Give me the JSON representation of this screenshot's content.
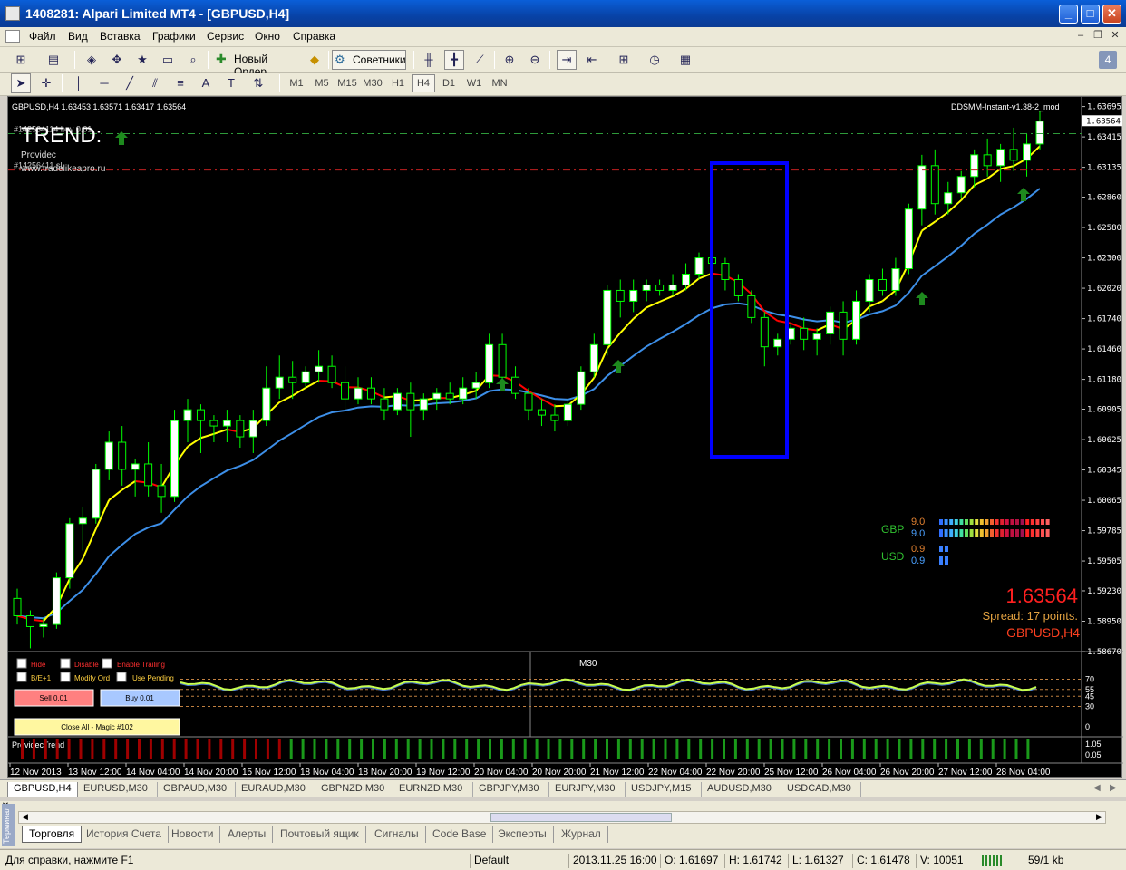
{
  "window": {
    "title": "1408281: Alpari Limited MT4 - [GBPUSD,H4]",
    "minimize": "_",
    "maximize": "□",
    "close": "✕"
  },
  "menu": [
    "Файл",
    "Вид",
    "Вставка",
    "Графики",
    "Сервис",
    "Окно",
    "Справка"
  ],
  "toolbar": {
    "new_order": "Новый Ордер",
    "experts": "Советники",
    "badge": "4"
  },
  "timeframes": [
    "M1",
    "M5",
    "M15",
    "M30",
    "H1",
    "H4",
    "D1",
    "W1",
    "MN"
  ],
  "active_timeframe": "H4",
  "chart": {
    "header": "GBPUSD,H4  1.63453 1.63571 1.63417 1.63564",
    "indicator_name": "DDSMM-Instant-v1.38-2_mod",
    "trend_label": "TREND:",
    "provider": "Providec",
    "site": "www.tradelikeapro.ru",
    "order_line1": "#142564114 buy 0.01",
    "order_line2": "#14256411 sl",
    "big_price": "1.63564",
    "spread": "Spread: 17 points.",
    "symbol_tf": "GBPUSD,H4",
    "gbp_label": "GBP",
    "usd_label": "USD",
    "gbp_vals": [
      "9.0",
      "9.0"
    ],
    "usd_vals": [
      "0.9",
      "0.9"
    ],
    "current_price_tag": "1.63564",
    "price_labels": [
      "1.63695",
      "1.63415",
      "1.63135",
      "1.62860",
      "1.62580",
      "1.62300",
      "1.62020",
      "1.61740",
      "1.61460",
      "1.61180",
      "1.60905",
      "1.60625",
      "1.60345",
      "1.60065",
      "1.59785",
      "1.59505",
      "1.59230",
      "1.58950",
      "1.58670"
    ],
    "time_labels": [
      "12 Nov 2013",
      "13 Nov 12:00",
      "14 Nov 04:00",
      "14 Nov 20:00",
      "15 Nov 12:00",
      "18 Nov 04:00",
      "18 Nov 20:00",
      "19 Nov 12:00",
      "20 Nov 04:00",
      "20 Nov 20:00",
      "21 Nov 12:00",
      "22 Nov 04:00",
      "22 Nov 20:00",
      "25 Nov 12:00",
      "26 Nov 04:00",
      "26 Nov 20:00",
      "27 Nov 12:00",
      "28 Nov 04:00"
    ],
    "sub1_label": "M30",
    "sub1_scale": [
      "70",
      "55",
      "45",
      "30",
      "0"
    ],
    "sub2_label": "ProvidecTrend",
    "sub2_scale": [
      "1.05",
      "0.05"
    ],
    "panel": {
      "hide": "Hide",
      "disable": "Disable",
      "enable_trailing": "Enable Trailing",
      "be": "B/E+1",
      "modify": "Modify Ord",
      "use_pending": "Use Pending",
      "sell": "Sell 0.01",
      "buy": "Buy 0.01",
      "close_all": "Close All - Magic #102"
    },
    "colors": {
      "bull": "#ffffff",
      "bear": "#000000",
      "wick": "#00ff00",
      "ma_fast_up": "#ffff00",
      "ma_fast_dn": "#ff0000",
      "ma_slow": "#3d8fe8",
      "box": "#0000ff"
    }
  },
  "symbol_tabs": [
    "GBPUSD,H4",
    "EURUSD,M30",
    "GBPAUD,M30",
    "EURAUD,M30",
    "GBPNZD,M30",
    "EURNZD,M30",
    "GBPJPY,M30",
    "EURJPY,M30",
    "USDJPY,M15",
    "AUDUSD,M30",
    "USDCAD,M30"
  ],
  "terminal_side": "Терминал",
  "terminal_tabs": [
    "Торговля",
    "История Счета",
    "Новости",
    "Алерты",
    "Почтовый ящик",
    "Сигналы",
    "Code Base",
    "Эксперты",
    "Журнал"
  ],
  "status": {
    "help": "Для справки, нажмите F1",
    "profile": "Default",
    "datetime": "2013.11.25 16:00",
    "open": "O: 1.61697",
    "high": "H: 1.61742",
    "low": "L: 1.61327",
    "close": "C: 1.61478",
    "volume": "V: 10051",
    "traffic": "59/1 kb"
  },
  "chart_data": {
    "type": "candlestick",
    "symbol": "GBPUSD",
    "timeframe": "H4",
    "ylim": [
      1.5867,
      1.637
    ],
    "candles": [
      [
        1.5916,
        1.5925,
        1.5892,
        1.59
      ],
      [
        1.59,
        1.5905,
        1.587,
        1.589
      ],
      [
        1.589,
        1.5898,
        1.588,
        1.5892
      ],
      [
        1.5892,
        1.594,
        1.5888,
        1.5935
      ],
      [
        1.5935,
        1.599,
        1.5925,
        1.5985
      ],
      [
        1.5985,
        1.6,
        1.596,
        1.599
      ],
      [
        1.599,
        1.604,
        1.5985,
        1.6035
      ],
      [
        1.6035,
        1.607,
        1.6025,
        1.606
      ],
      [
        1.606,
        1.6075,
        1.602,
        1.6035
      ],
      [
        1.6035,
        1.6045,
        1.601,
        1.604
      ],
      [
        1.604,
        1.606,
        1.601,
        1.602
      ],
      [
        1.602,
        1.604,
        1.5995,
        1.601
      ],
      [
        1.601,
        1.609,
        1.6005,
        1.608
      ],
      [
        1.608,
        1.61,
        1.606,
        1.609
      ],
      [
        1.609,
        1.6095,
        1.605,
        1.608
      ],
      [
        1.608,
        1.6085,
        1.606,
        1.6075
      ],
      [
        1.6075,
        1.609,
        1.606,
        1.608
      ],
      [
        1.608,
        1.6085,
        1.6055,
        1.6065
      ],
      [
        1.6065,
        1.609,
        1.605,
        1.608
      ],
      [
        1.608,
        1.613,
        1.6075,
        1.611
      ],
      [
        1.611,
        1.614,
        1.61,
        1.612
      ],
      [
        1.612,
        1.6135,
        1.61,
        1.6115
      ],
      [
        1.6115,
        1.613,
        1.611,
        1.6125
      ],
      [
        1.6125,
        1.6145,
        1.6115,
        1.613
      ],
      [
        1.613,
        1.614,
        1.611,
        1.6115
      ],
      [
        1.6115,
        1.613,
        1.609,
        1.61
      ],
      [
        1.61,
        1.612,
        1.6095,
        1.611
      ],
      [
        1.611,
        1.612,
        1.6095,
        1.61
      ],
      [
        1.61,
        1.611,
        1.608,
        1.609
      ],
      [
        1.609,
        1.611,
        1.6085,
        1.6105
      ],
      [
        1.6105,
        1.6115,
        1.6065,
        1.609
      ],
      [
        1.609,
        1.6105,
        1.608,
        1.61
      ],
      [
        1.61,
        1.611,
        1.609,
        1.6105
      ],
      [
        1.6105,
        1.6115,
        1.6095,
        1.61
      ],
      [
        1.61,
        1.612,
        1.6095,
        1.611
      ],
      [
        1.611,
        1.6125,
        1.61,
        1.6115
      ],
      [
        1.6115,
        1.616,
        1.611,
        1.615
      ],
      [
        1.615,
        1.616,
        1.611,
        1.612
      ],
      [
        1.612,
        1.613,
        1.61,
        1.6105
      ],
      [
        1.6105,
        1.611,
        1.608,
        1.609
      ],
      [
        1.609,
        1.61,
        1.6075,
        1.6085
      ],
      [
        1.6085,
        1.6095,
        1.607,
        1.608
      ],
      [
        1.608,
        1.61,
        1.6075,
        1.6095
      ],
      [
        1.6095,
        1.613,
        1.609,
        1.6125
      ],
      [
        1.6125,
        1.616,
        1.612,
        1.615
      ],
      [
        1.615,
        1.6205,
        1.614,
        1.62
      ],
      [
        1.62,
        1.621,
        1.6175,
        1.619
      ],
      [
        1.619,
        1.621,
        1.618,
        1.62
      ],
      [
        1.62,
        1.621,
        1.619,
        1.6205
      ],
      [
        1.6205,
        1.621,
        1.6195,
        1.62
      ],
      [
        1.62,
        1.6215,
        1.6195,
        1.6205
      ],
      [
        1.6205,
        1.6225,
        1.62,
        1.6215
      ],
      [
        1.6215,
        1.6235,
        1.621,
        1.623
      ],
      [
        1.623,
        1.624,
        1.622,
        1.6225
      ],
      [
        1.6225,
        1.623,
        1.62,
        1.621
      ],
      [
        1.621,
        1.6215,
        1.619,
        1.6195
      ],
      [
        1.6195,
        1.62,
        1.617,
        1.6175
      ],
      [
        1.6175,
        1.618,
        1.613,
        1.6148
      ],
      [
        1.6148,
        1.616,
        1.614,
        1.6155
      ],
      [
        1.6155,
        1.617,
        1.615,
        1.6165
      ],
      [
        1.6165,
        1.6175,
        1.6145,
        1.6155
      ],
      [
        1.6155,
        1.6165,
        1.614,
        1.616
      ],
      [
        1.616,
        1.6185,
        1.615,
        1.618
      ],
      [
        1.618,
        1.619,
        1.614,
        1.6155
      ],
      [
        1.6155,
        1.62,
        1.615,
        1.619
      ],
      [
        1.619,
        1.6215,
        1.618,
        1.621
      ],
      [
        1.621,
        1.622,
        1.6195,
        1.62
      ],
      [
        1.62,
        1.623,
        1.6195,
        1.622
      ],
      [
        1.622,
        1.628,
        1.6215,
        1.6275
      ],
      [
        1.6275,
        1.6325,
        1.626,
        1.6315
      ],
      [
        1.6315,
        1.633,
        1.627,
        1.628
      ],
      [
        1.628,
        1.63,
        1.627,
        1.629
      ],
      [
        1.629,
        1.631,
        1.6285,
        1.6305
      ],
      [
        1.6305,
        1.633,
        1.6295,
        1.6325
      ],
      [
        1.6325,
        1.634,
        1.6305,
        1.6315
      ],
      [
        1.6315,
        1.6335,
        1.63,
        1.633
      ],
      [
        1.633,
        1.635,
        1.631,
        1.632
      ],
      [
        1.632,
        1.6345,
        1.6305,
        1.6335
      ],
      [
        1.6335,
        1.6365,
        1.633,
        1.6356
      ]
    ]
  }
}
